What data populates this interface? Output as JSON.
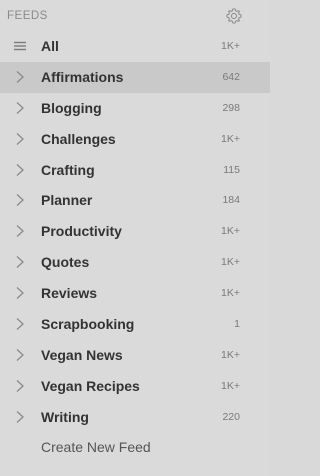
{
  "header": {
    "title": "FEEDS",
    "settings_icon": "gear-icon"
  },
  "feeds": [
    {
      "label": "All",
      "count": "1K+",
      "icon": "menu-lines-icon",
      "selected": false
    },
    {
      "label": "Affirmations",
      "count": "642",
      "icon": "chevron-right-icon",
      "selected": true
    },
    {
      "label": "Blogging",
      "count": "298",
      "icon": "chevron-right-icon",
      "selected": false
    },
    {
      "label": "Challenges",
      "count": "1K+",
      "icon": "chevron-right-icon",
      "selected": false
    },
    {
      "label": "Crafting",
      "count": "115",
      "icon": "chevron-right-icon",
      "selected": false
    },
    {
      "label": "Planner",
      "count": "184",
      "icon": "chevron-right-icon",
      "selected": false
    },
    {
      "label": "Productivity",
      "count": "1K+",
      "icon": "chevron-right-icon",
      "selected": false
    },
    {
      "label": "Quotes",
      "count": "1K+",
      "icon": "chevron-right-icon",
      "selected": false
    },
    {
      "label": "Reviews",
      "count": "1K+",
      "icon": "chevron-right-icon",
      "selected": false
    },
    {
      "label": "Scrapbooking",
      "count": "1",
      "icon": "chevron-right-icon",
      "selected": false
    },
    {
      "label": "Vegan News",
      "count": "1K+",
      "icon": "chevron-right-icon",
      "selected": false
    },
    {
      "label": "Vegan Recipes",
      "count": "1K+",
      "icon": "chevron-right-icon",
      "selected": false
    },
    {
      "label": "Writing",
      "count": "220",
      "icon": "chevron-right-icon",
      "selected": false
    }
  ],
  "create_feed": {
    "label": "Create New Feed"
  },
  "colors": {
    "background": "#dadada",
    "selected_row": "#c9c9c9",
    "label_text": "#333333",
    "count_text": "#7a7a7a",
    "header_text": "#8a8a8a"
  }
}
